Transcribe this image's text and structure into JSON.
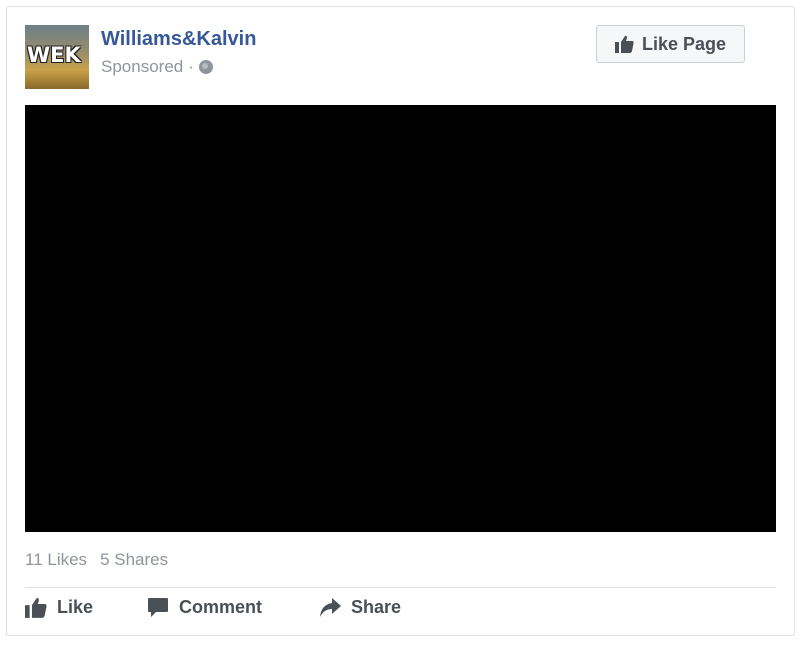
{
  "post": {
    "page_name": "Williams&Kalvin",
    "avatar_logo_text": "WEK",
    "sponsored_label": "Sponsored",
    "separator": "·",
    "like_page_label": "Like Page",
    "stats": {
      "likes": "11 Likes",
      "shares": "5 Shares"
    },
    "actions": {
      "like": "Like",
      "comment": "Comment",
      "share": "Share"
    }
  },
  "colors": {
    "link_blue": "#365899",
    "meta_gray": "#90949c",
    "action_gray": "#4b4f56",
    "video_bg": "#000000"
  },
  "icons": [
    "globe-icon",
    "thumbs-up-icon",
    "comment-icon",
    "share-arrow-icon"
  ]
}
